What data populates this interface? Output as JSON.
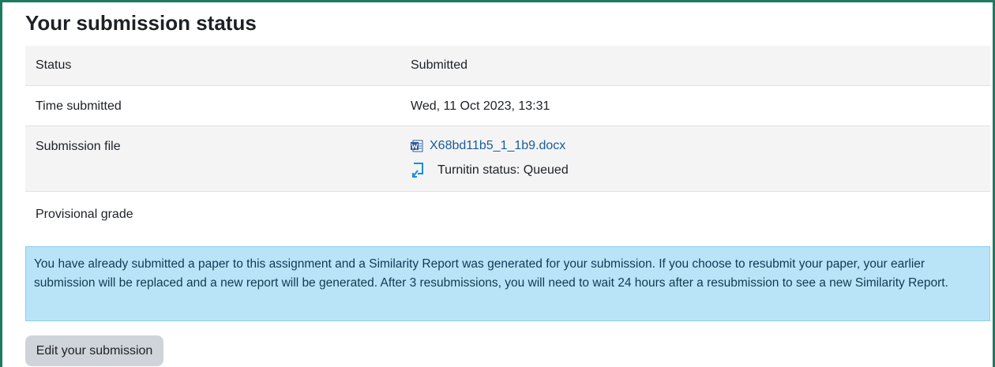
{
  "heading": "Your submission status",
  "rows": [
    {
      "label": "Status",
      "value": "Submitted"
    },
    {
      "label": "Time submitted",
      "value": "Wed, 11 Oct 2023, 13:31"
    },
    {
      "label": "Submission file",
      "file_name": "X68bd11b5_1_1b9.docx",
      "turnitin_status": "Turnitin status: Queued"
    },
    {
      "label": "Provisional grade",
      "value": ""
    }
  ],
  "notice": "You have already submitted a paper to this assignment and a Similarity Report was generated for your submission. If you choose to resubmit your paper, your earlier submission will be replaced and a new report will be generated. After 3 resubmissions, you will need to wait 24 hours after a resubmission to see a new Similarity Report.",
  "edit_button": "Edit your submission",
  "icons": {
    "file": "word-document-icon",
    "turnitin": "turnitin-icon"
  },
  "colors": {
    "frame": "#1e7a5e",
    "link": "#1a5c9a",
    "notice_bg": "#b9e4f8",
    "button_bg": "#ced4da"
  }
}
